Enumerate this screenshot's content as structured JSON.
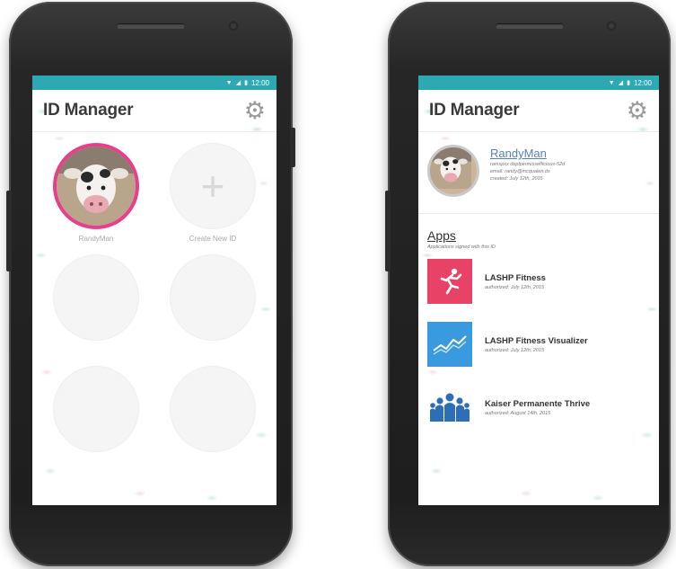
{
  "left_phone": {
    "statusbar": {
      "time": "12:00"
    },
    "header": {
      "title": "ID Manager"
    },
    "ids": [
      {
        "label": "RandyMan",
        "kind": "avatar"
      },
      {
        "label": "Create New ID",
        "kind": "add"
      },
      {
        "label": "",
        "kind": "empty"
      },
      {
        "label": "",
        "kind": "empty"
      },
      {
        "label": "",
        "kind": "empty"
      },
      {
        "label": "",
        "kind": "empty"
      }
    ],
    "add_symbol": "+"
  },
  "right_phone": {
    "statusbar": {
      "time": "12:00"
    },
    "header": {
      "title": "ID Manager"
    },
    "profile": {
      "name": "RandyMan",
      "lines": [
        "ramspxx deplpermissefficious-52d",
        "email: randy@mcqualen.ds",
        "created: July 12th, 2015"
      ]
    },
    "apps": {
      "title": "Apps",
      "subtitle": "Applications signed with this ID",
      "items": [
        {
          "name": "LASHP Fitness",
          "date": "authorized: July 12th, 2015",
          "icon": "runner-icon"
        },
        {
          "name": "LASHP Fitness Visualizer",
          "date": "authorized: July 12th, 2015",
          "icon": "chart-icon"
        },
        {
          "name": "Kaiser Permanente Thrive",
          "date": "authorized: August 14th, 2015",
          "icon": "people-icon"
        }
      ]
    }
  },
  "colors": {
    "statusbar": "#2ea9b3",
    "avatar_ring": "#e83e8c",
    "link": "#5b7fb8",
    "fitness_icon_bg": "#e84266",
    "visualizer_icon_bg": "#3a9ae0",
    "thrive_icon": "#2d6fb7"
  }
}
